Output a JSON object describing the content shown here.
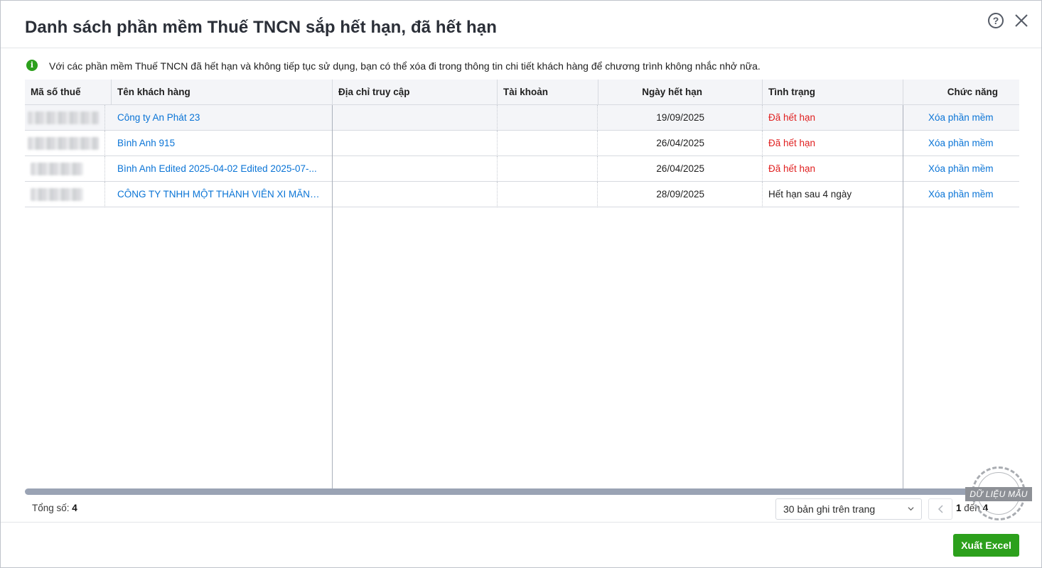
{
  "dialog": {
    "title": "Danh sách phần mềm Thuế TNCN sắp hết hạn, đã hết hạn",
    "help_symbol": "?"
  },
  "notice": {
    "icon": "info-icon",
    "icon_glyph": "i",
    "text": "Với các phần mềm Thuế TNCN đã hết hạn và không tiếp tục sử dụng, bạn có thể xóa đi trong thông tin chi tiết khách hàng để chương trình không nhắc nhở nữa."
  },
  "table": {
    "columns": [
      "Mã số thuế",
      "Tên khách hàng",
      "Địa chỉ truy cập",
      "Tài khoản",
      "Ngày hết hạn",
      "Tình trạng",
      "Chức năng"
    ],
    "rows": [
      {
        "tax_code": "",
        "customer": "Công ty An Phát 23",
        "address": "",
        "account": "",
        "expiry": "19/09/2025",
        "status": "Đã hết hạn",
        "status_type": "expired",
        "action": "Xóa phần mềm"
      },
      {
        "tax_code": "",
        "customer": "Bình Anh 915",
        "address": "",
        "account": "",
        "expiry": "26/04/2025",
        "status": "Đã hết hạn",
        "status_type": "expired",
        "action": "Xóa phần mềm"
      },
      {
        "tax_code": "",
        "customer": "Bình Anh Edited 2025-04-02 Edited 2025-07-...",
        "address": "",
        "account": "",
        "expiry": "26/04/2025",
        "status": "Đã hết hạn",
        "status_type": "expired",
        "action": "Xóa phần mềm"
      },
      {
        "tax_code": "",
        "customer": "CÔNG TY TNHH MỘT THÀNH VIÊN XI MĂNG...",
        "address": "",
        "account": "",
        "expiry": "28/09/2025",
        "status": "Hết hạn sau 4 ngày",
        "status_type": "soon",
        "action": "Xóa phần mềm"
      }
    ]
  },
  "footer": {
    "total_label": "Tổng số:",
    "total_value": "4",
    "page_size": "30 bản ghi trên trang",
    "range_from": "1",
    "range_sep": "đến",
    "range_to": "4"
  },
  "watermark": {
    "text": "DỮ LIỆU MẪU"
  },
  "actions": {
    "export_label": "Xuất Excel"
  },
  "colors": {
    "link": "#0a74d6",
    "expired": "#e02020",
    "primary": "#2ca01c"
  }
}
